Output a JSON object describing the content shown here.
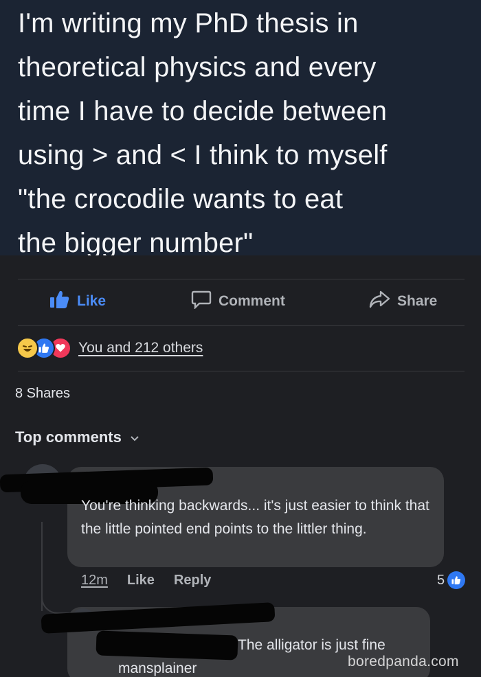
{
  "post": {
    "text": "I'm writing my PhD thesis in\ntheoretical physics and every\ntime I have to decide between\nusing > and < I think to myself\n\"the crocodile wants to eat\nthe bigger number\""
  },
  "actions": {
    "like": "Like",
    "comment": "Comment",
    "share": "Share"
  },
  "reactions": {
    "icons": [
      "haha-icon",
      "like-icon",
      "love-icon"
    ],
    "summary": "You and 212 others"
  },
  "shares": "8 Shares",
  "top_comments": {
    "label": "Top comments"
  },
  "comments": [
    {
      "text": "You're thinking backwards... it's just easier to think that the little pointed end points to the littler thing.",
      "time": "12m",
      "like_label": "Like",
      "reply_label": "Reply",
      "like_count": "5"
    }
  ],
  "reply": {
    "text_line1": "The alligator is just fine",
    "text_line2": "mansplainer"
  },
  "watermark": "boredpanda.com",
  "colors": {
    "post_background": "#1b2433",
    "page_background": "#1e1f23",
    "like_blue": "#4b8cf7",
    "bubble": "#3a3b3e"
  }
}
